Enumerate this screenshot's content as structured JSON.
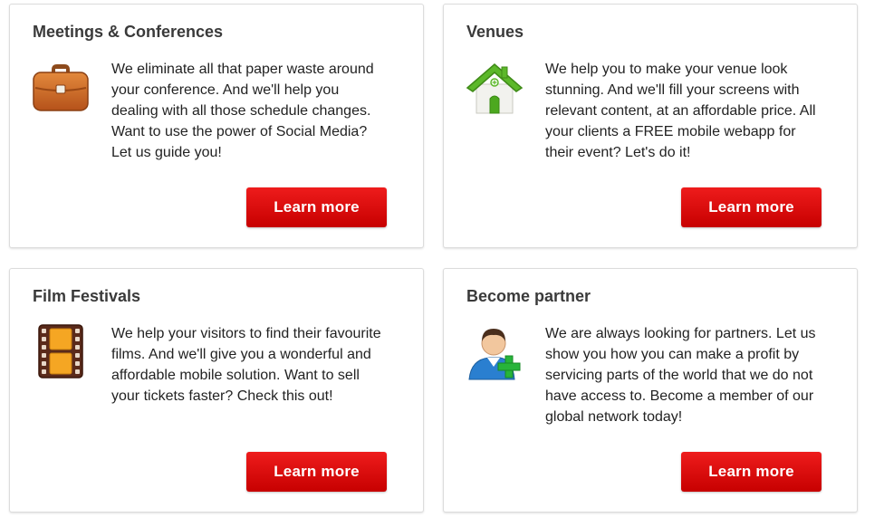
{
  "cards": [
    {
      "title": "Meetings & Conferences",
      "icon": "briefcase-icon",
      "text": "We eliminate all that paper waste around your conference. And we'll help you dealing with all those schedule changes. Want to use the power of Social Media? Let us guide you!",
      "button": "Learn more"
    },
    {
      "title": "Venues",
      "icon": "house-icon",
      "text": "We help you to make your venue look stunning. And we'll fill your screens with relevant content, at an affordable price. All your clients a FREE mobile webapp for their event? Let's do it!",
      "button": "Learn more"
    },
    {
      "title": "Film Festivals",
      "icon": "film-strip-icon",
      "text": "We help your visitors to find their favourite films. And we'll give you a wonderful and affordable mobile solution. Want to sell your tickets faster? Check this out!",
      "button": "Learn more"
    },
    {
      "title": "Become partner",
      "icon": "add-user-icon",
      "text": "We are always looking for partners. Let us show you how you can make a profit by servicing parts of the world that we do not have access to. Become a member of our global network today!",
      "button": "Learn more"
    }
  ],
  "colors": {
    "button": "#dd0a0a",
    "title": "#3a3a3a",
    "border": "#dcdcdc"
  }
}
